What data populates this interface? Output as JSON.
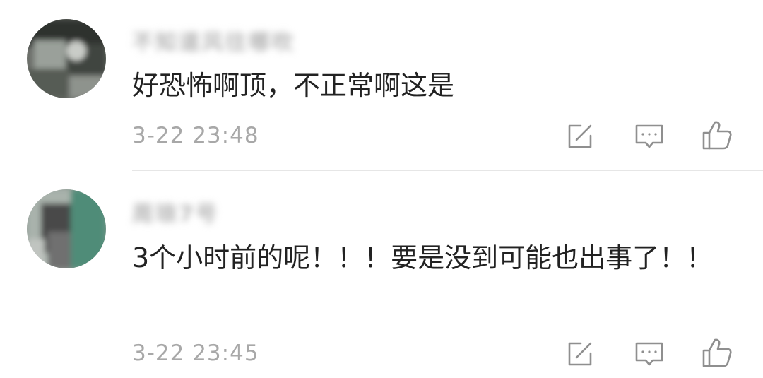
{
  "comments": [
    {
      "username": "不知道风往哪吹",
      "text": "好恐怖啊顶，不正常啊这是",
      "time": "3-22 23:48",
      "actions": [
        "edit-icon",
        "comment-icon",
        "thumbs-up-icon"
      ]
    },
    {
      "username": "周琅7号",
      "text": "3个小时前的呢！！！要是没到可能也出事了！！",
      "time": "3-22 23:45",
      "actions": [
        "edit-icon",
        "comment-icon",
        "thumbs-up-icon"
      ]
    }
  ],
  "colors": {
    "text": "#222222",
    "timestamp": "#a8a8a8",
    "icon": "#8f8f8f",
    "divider": "#e6e6e6"
  }
}
